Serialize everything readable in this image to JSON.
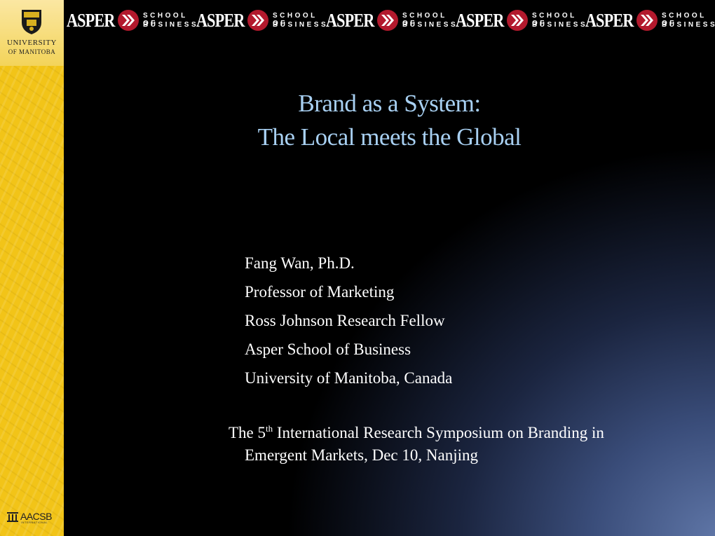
{
  "banner": {
    "units": [
      {
        "brand": "ASPER",
        "line1": "SCHOOL OF",
        "line2": "BUSINESS"
      },
      {
        "brand": "ASPER",
        "line1": "SCHOOL OF",
        "line2": "BUSINESS"
      },
      {
        "brand": "ASPER",
        "line1": "SCHOOL OF",
        "line2": "BUSINESS"
      },
      {
        "brand": "ASPER",
        "line1": "SCHOOL OF",
        "line2": "BUSINESS"
      },
      {
        "brand": "ASPER",
        "line1": "SCHOOL OF",
        "line2": "BUSINESS"
      }
    ],
    "chevron_color": "#b3192d"
  },
  "university_logo": {
    "line1": "UNIVERSITY",
    "line2": "OF MANITOBA"
  },
  "accreditation": {
    "name": "AACSB",
    "sub": "INTERNATIONAL"
  },
  "title": {
    "line1": "Brand as a System:",
    "line2": "The Local meets the Global",
    "color": "#a8d0f2"
  },
  "author": {
    "lines": [
      "Fang Wan, Ph.D.",
      "Professor of  Marketing",
      "Ross Johnson Research Fellow",
      "Asper School of  Business",
      "University of  Manitoba, Canada"
    ]
  },
  "event": {
    "prefix": "The 5",
    "ordinal": "th",
    "rest": " International Research Symposium on Branding in",
    "line2": "Emergent Markets, Dec 10, Nanjing"
  },
  "colors": {
    "band_yellow": "#f2c418",
    "background": "#000000",
    "glow": "#6077a8"
  }
}
